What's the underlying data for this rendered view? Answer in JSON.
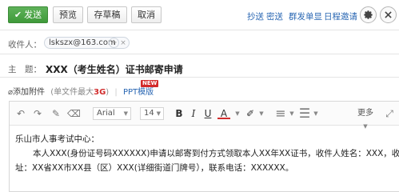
{
  "toolbar": {
    "send_label": "发送",
    "preview_label": "预览",
    "draft_label": "存草稿",
    "cancel_label": "取消",
    "links": [
      "抄送",
      "密送",
      "群发单显",
      "日程邀请"
    ]
  },
  "compose": {
    "recipient_label": "收件人：",
    "recipient": "lskszx@163.com",
    "subject_label": "主　题：",
    "subject": "XXX（考生姓名）证书邮寄申请"
  },
  "attachment": {
    "add_label": "添加附件",
    "limit_prefix": "(单文件最大",
    "limit_value": "3G",
    "limit_suffix": ")",
    "ppt_label": "PPT模版",
    "badge": "NEW"
  },
  "editor": {
    "font": "Arial",
    "size": "14",
    "more_label": "更多",
    "line1": "乐山市人事考试中心：",
    "line2": "本人XXX(身份证号码XXXXXX)申请以邮寄到付方式领取本人XX年XX证书，收件人姓名：XXX，收件地",
    "line3": "址：XX省XX市XX县（区）XXX(详细街道门牌号），联系电话：XXXXXX。"
  },
  "colors": {
    "send": "#4aa544",
    "link": "#2a67b3",
    "badge": "#d32a2a",
    "accent_red": "#d12c2c"
  },
  "icons": [
    "checkmark-icon",
    "gear-icon",
    "close-icon",
    "paperclip-icon",
    "undo-icon",
    "redo-icon",
    "brush-icon",
    "eraser-icon",
    "text-color-icon",
    "highlight-icon",
    "fullscreen-icon"
  ]
}
